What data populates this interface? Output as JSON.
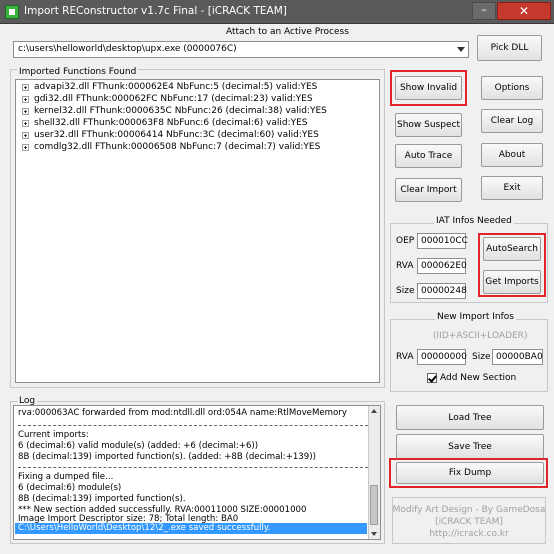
{
  "window": {
    "title": "Import REConstructor v1.7c Final - [iCRACK TEAM]",
    "minimize_glyph": "–",
    "close_glyph": "✕",
    "icon": "app-icon"
  },
  "attach": {
    "label": "Attach to an Active Process",
    "process": "c:\\users\\helloworld\\desktop\\upx.exe (0000076C)",
    "pick_dll": "Pick DLL"
  },
  "imported_functions": {
    "label": "Imported Functions Found",
    "items": [
      "advapi32.dll FThunk:000062E4 NbFunc:5 (decimal:5) valid:YES",
      "gdi32.dll FThunk:000062FC NbFunc:17 (decimal:23) valid:YES",
      "kernel32.dll FThunk:0000635C NbFunc:26 (decimal:38) valid:YES",
      "shell32.dll FThunk:000063F8 NbFunc:6 (decimal:6) valid:YES",
      "user32.dll FThunk:00006414 NbFunc:3C (decimal:60) valid:YES",
      "comdlg32.dll FThunk:00006508 NbFunc:7 (decimal:7) valid:YES"
    ]
  },
  "buttons": {
    "show_invalid": "Show Invalid",
    "options": "Options",
    "show_suspect": "Show Suspect",
    "clear_log": "Clear Log",
    "auto_trace": "Auto Trace",
    "about": "About",
    "clear_import": "Clear Import",
    "exit": "Exit",
    "auto_search": "AutoSearch",
    "get_imports": "Get Imports",
    "load_tree": "Load Tree",
    "save_tree": "Save Tree",
    "fix_dump": "Fix Dump"
  },
  "iat": {
    "label": "IAT Infos Needed",
    "oep_label": "OEP",
    "oep_value": "000010CC",
    "rva_label": "RVA",
    "rva_value": "000062E0",
    "size_label": "Size",
    "size_value": "00000248"
  },
  "new_import": {
    "label": "New Import Infos",
    "subtitle": "(IID+ASCII+LOADER)",
    "rva_label": "RVA",
    "rva_value": "00000000",
    "size_label": "Size",
    "size_value": "00000BA0",
    "add_section_label": "Add New Section",
    "add_section_checked": true
  },
  "log": {
    "label": "Log",
    "lines": [
      "rva:000063AC forwarded from mod:ntdll.dll ord:054A name:RtlMoveMemory",
      "Current imports:",
      "6 (decimal:6) valid module(s) (added: +6 (decimal:+6))",
      "8B (decimal:139) imported function(s). (added: +8B (decimal:+139))",
      "Fixing a dumped file...",
      "6 (decimal:6) module(s)",
      "8B (decimal:139) imported function(s).",
      "*** New section added successfully. RVA:00011000 SIZE:00001000",
      "Image Import Descriptor size: 78; Total length: BA0"
    ],
    "selected_line": "C:\\Users\\HelloWorld\\Desktop\\12\\2_.exe saved successfully."
  },
  "credits": {
    "line1": "Modify Art Design - By GameDosa",
    "line2": "[iCRACK TEAM]",
    "line3": "http://icrack.co.kr"
  }
}
